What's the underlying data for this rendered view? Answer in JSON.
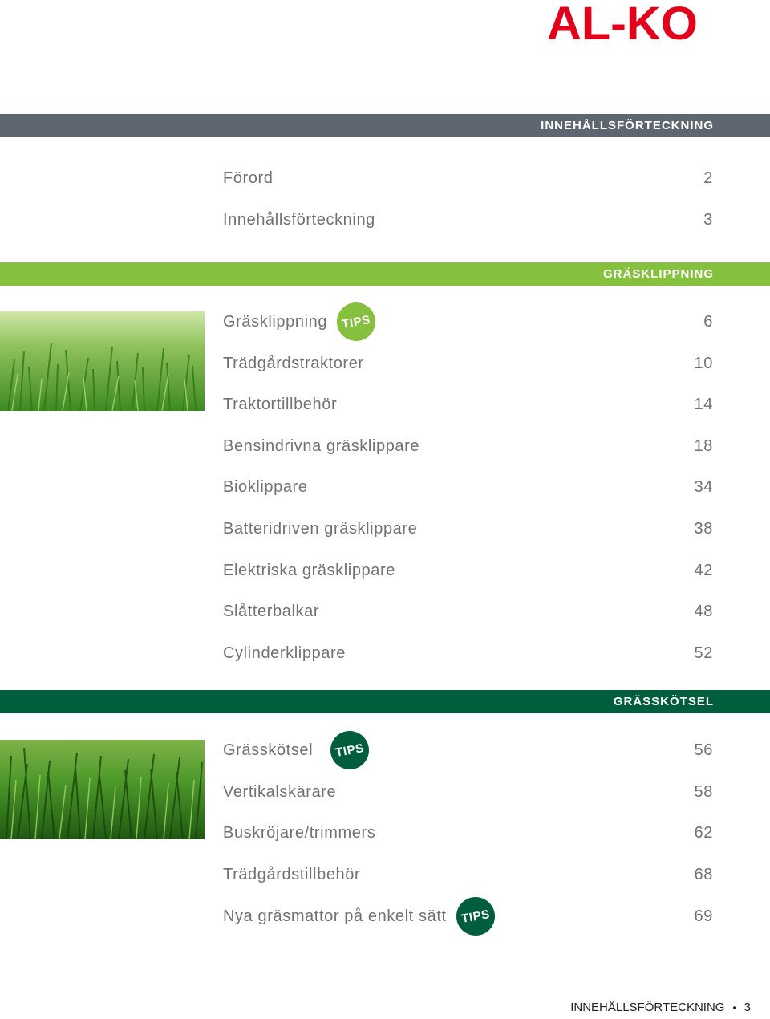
{
  "brand": {
    "logo_text": "AL-KO",
    "color": "#e2001a"
  },
  "colors": {
    "intro_band": "#5e6670",
    "clipping_band": "#86c03f",
    "care_band": "#005e3c",
    "text": "#6f7175"
  },
  "sections": {
    "intro": {
      "title": "INNEHÅLLSFÖRTECKNING",
      "entries": [
        {
          "label": "Förord",
          "page": "2"
        },
        {
          "label": "Innehållsförteckning",
          "page": "3"
        }
      ]
    },
    "clipping": {
      "title": "GRÄSKLIPPNING",
      "image_icon": "grass-photo",
      "entries": [
        {
          "label": "Gräsklippning",
          "page": "6",
          "badge": "TIPS"
        },
        {
          "label": "Trädgårdstraktorer",
          "page": "10"
        },
        {
          "label": "Traktortillbehör",
          "page": "14"
        },
        {
          "label": "Bensindrivna gräsklippare",
          "page": "18"
        },
        {
          "label": "Bioklippare",
          "page": "34"
        },
        {
          "label": "Batteridriven gräsklippare",
          "page": "38"
        },
        {
          "label": "Elektriska gräsklippare",
          "page": "42"
        },
        {
          "label": "Slåtterbalkar",
          "page": "48"
        },
        {
          "label": "Cylinderklippare",
          "page": "52"
        }
      ]
    },
    "care": {
      "title": "GRÄSSKÖTSEL",
      "image_icon": "grass-photo",
      "entries": [
        {
          "label": "Grässkötsel",
          "page": "56",
          "badge": "TIPS"
        },
        {
          "label": "Vertikalskärare",
          "page": "58"
        },
        {
          "label": "Buskröjare/trimmers",
          "page": "62"
        },
        {
          "label": "Trädgårdstillbehör",
          "page": "68"
        },
        {
          "label": "Nya gräsmattor på enkelt sätt",
          "page": "69",
          "badge": "TIPS"
        }
      ]
    }
  },
  "footer": {
    "label": "INNEHÅLLSFÖRTECKNING",
    "separator": "•",
    "page": "3"
  }
}
